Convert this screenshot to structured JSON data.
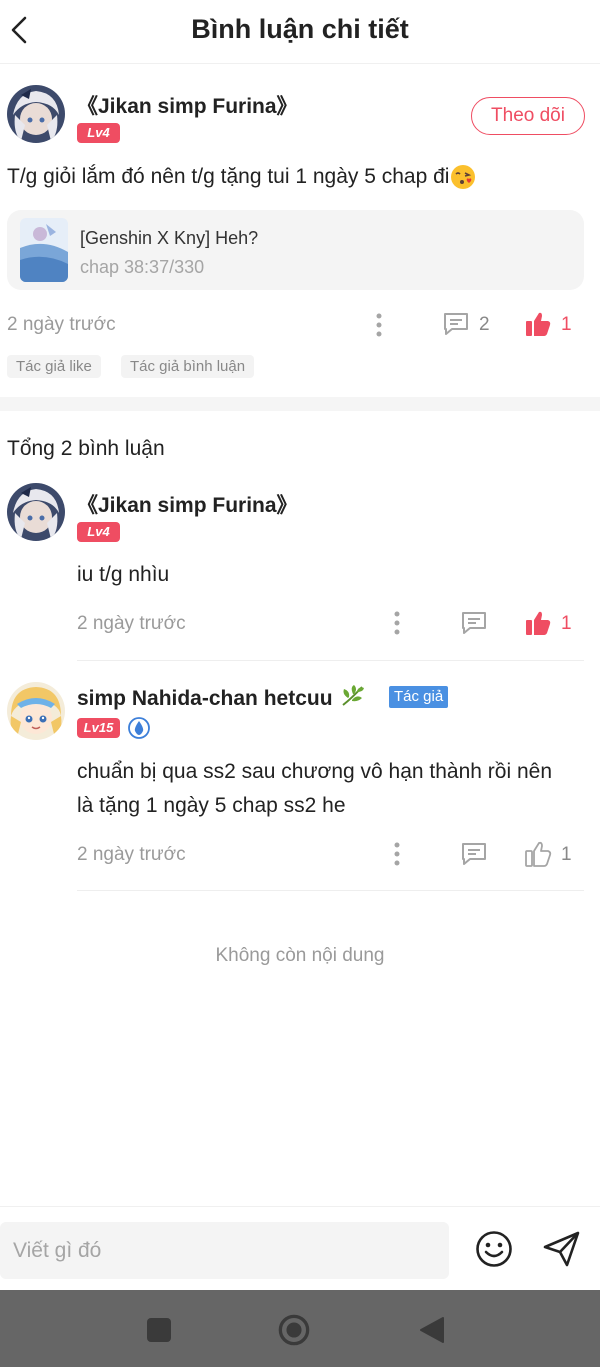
{
  "header": {
    "title": "Bình luận chi tiết",
    "back_icon": "chevron-left-icon"
  },
  "post": {
    "username": "《Jikan simp Furina》",
    "level": "Lv4",
    "follow_label": "Theo dõi",
    "text": "T/g giỏi lắm đó nên t/g tặng tui 1 ngày 5 chap đi",
    "emoji": "kissing-face-emoji",
    "story": {
      "title": "[Genshin X Kny] Heh?",
      "chapter": "chap 38:37/330"
    },
    "time": "2 ngày trước",
    "reply_count": "2",
    "like_count": "1",
    "tags": [
      "Tác giả like",
      "Tác giả bình luận"
    ]
  },
  "total_label": "Tổng 2 bình luận",
  "comments": [
    {
      "username": "《Jikan simp Furina》",
      "level": "Lv4",
      "text": "iu t/g nhìu",
      "time": "2 ngày trước",
      "like_count": "1",
      "liked": true
    },
    {
      "username": "simp Nahida-chan hetcuu",
      "username_emoji": "leaf-icon",
      "author_badge": "Tác giả",
      "level": "Lv15",
      "text_line1": "chuẩn bị qua ss2 sau chương vô hạn thành rồi nên",
      "text_line2": "là tặng 1 ngày 5 chap ss2 he",
      "time": "2 ngày trước",
      "like_count": "1",
      "liked": false
    }
  ],
  "end_label": "Không còn nội dung",
  "input": {
    "placeholder": "Viết gì đó"
  },
  "colors": {
    "accent": "#ef4d62",
    "author_blue": "#4a90e2",
    "muted": "#9a9a9a"
  }
}
